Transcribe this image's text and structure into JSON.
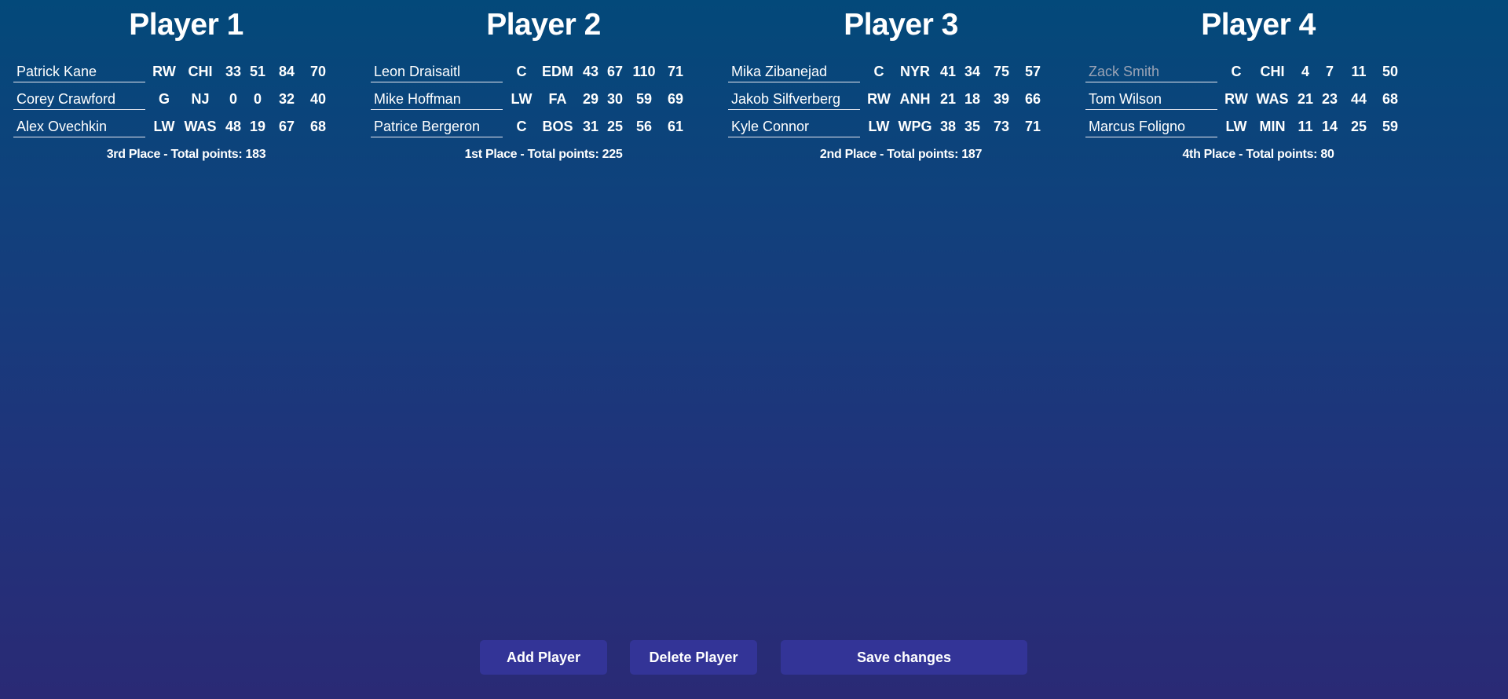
{
  "players": [
    {
      "title": "Player 1",
      "summary": "3rd Place - Total points: 183",
      "roster": [
        {
          "name": "Patrick Kane",
          "placeholder": "",
          "pos": "RW",
          "team": "CHI",
          "g": "33",
          "a": "51",
          "p": "84",
          "o": "70"
        },
        {
          "name": "Corey Crawford",
          "placeholder": "",
          "pos": "G",
          "team": "NJ",
          "g": "0",
          "a": "0",
          "p": "32",
          "o": "40"
        },
        {
          "name": "Alex Ovechkin",
          "placeholder": "",
          "pos": "LW",
          "team": "WAS",
          "g": "48",
          "a": "19",
          "p": "67",
          "o": "68"
        }
      ]
    },
    {
      "title": "Player 2",
      "summary": "1st Place - Total points: 225",
      "roster": [
        {
          "name": "Leon Draisaitl",
          "placeholder": "",
          "pos": "C",
          "team": "EDM",
          "g": "43",
          "a": "67",
          "p": "110",
          "o": "71"
        },
        {
          "name": "Mike Hoffman",
          "placeholder": "",
          "pos": "LW",
          "team": "FA",
          "g": "29",
          "a": "30",
          "p": "59",
          "o": "69"
        },
        {
          "name": "Patrice Bergeron",
          "placeholder": "",
          "pos": "C",
          "team": "BOS",
          "g": "31",
          "a": "25",
          "p": "56",
          "o": "61"
        }
      ]
    },
    {
      "title": "Player 3",
      "summary": "2nd Place - Total points: 187",
      "roster": [
        {
          "name": "Mika Zibanejad",
          "placeholder": "",
          "pos": "C",
          "team": "NYR",
          "g": "41",
          "a": "34",
          "p": "75",
          "o": "57"
        },
        {
          "name": "Jakob Silfverberg",
          "placeholder": "",
          "pos": "RW",
          "team": "ANH",
          "g": "21",
          "a": "18",
          "p": "39",
          "o": "66"
        },
        {
          "name": "Kyle Connor",
          "placeholder": "",
          "pos": "LW",
          "team": "WPG",
          "g": "38",
          "a": "35",
          "p": "73",
          "o": "71"
        }
      ]
    },
    {
      "title": "Player 4",
      "summary": "4th Place - Total points: 80",
      "roster": [
        {
          "name": "",
          "placeholder": "Zack Smith",
          "pos": "C",
          "team": "CHI",
          "g": "4",
          "a": "7",
          "p": "11",
          "o": "50"
        },
        {
          "name": "Tom Wilson",
          "placeholder": "",
          "pos": "RW",
          "team": "WAS",
          "g": "21",
          "a": "23",
          "p": "44",
          "o": "68"
        },
        {
          "name": "Marcus Foligno",
          "placeholder": "",
          "pos": "LW",
          "team": "MIN",
          "g": "11",
          "a": "14",
          "p": "25",
          "o": "59"
        }
      ]
    }
  ],
  "actions": {
    "add_label": "Add Player",
    "delete_label": "Delete Player",
    "save_label": "Save changes"
  },
  "colors": {
    "gradient_top": "#03497a",
    "gradient_bottom": "#2a2a75",
    "button_bg": "#333497",
    "placeholder_text": "#9aa3b5"
  }
}
